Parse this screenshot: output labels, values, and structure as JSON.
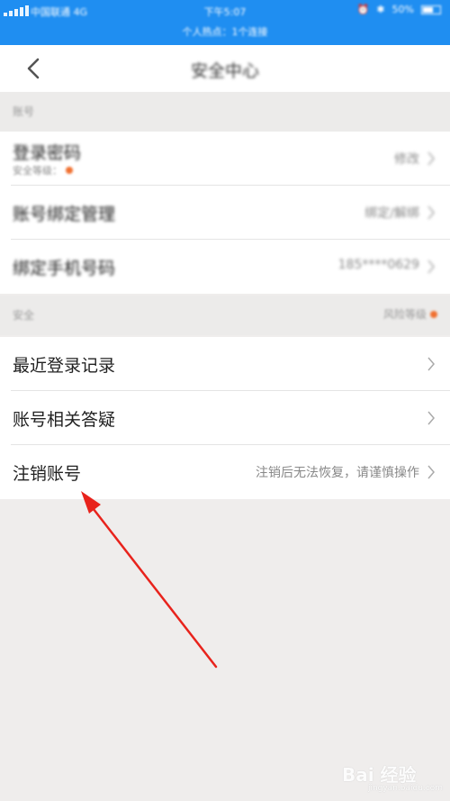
{
  "status_bar": {
    "carrier": "中国联通 4G",
    "time": "下午5:07",
    "subtitle": "个人热点：1个连接",
    "battery": "50%"
  },
  "nav": {
    "title": "安全中心",
    "back_icon": "chevron-left-icon"
  },
  "account_section": {
    "label": "账号",
    "items": [
      {
        "title": "登录密码",
        "subtitle": "安全等级：",
        "value": "修改"
      },
      {
        "title": "账号绑定管理",
        "value": "绑定/解绑"
      },
      {
        "title": "绑定手机号码",
        "value": "185****0629"
      }
    ]
  },
  "security_section": {
    "label": "安全",
    "hint": "风险等级",
    "items": [
      {
        "title": "最近登录记录",
        "value": ""
      },
      {
        "title": "账号相关答疑",
        "value": ""
      },
      {
        "title": "注销账号",
        "value": "注销后无法恢复，请谨慎操作"
      }
    ]
  },
  "colors": {
    "status_bar": "#1f8ef1",
    "annotation_arrow": "#e8231c",
    "badge": "#f07030"
  },
  "watermark": {
    "brand": "Bai 经验",
    "url": "jingyan.baidu.com"
  }
}
